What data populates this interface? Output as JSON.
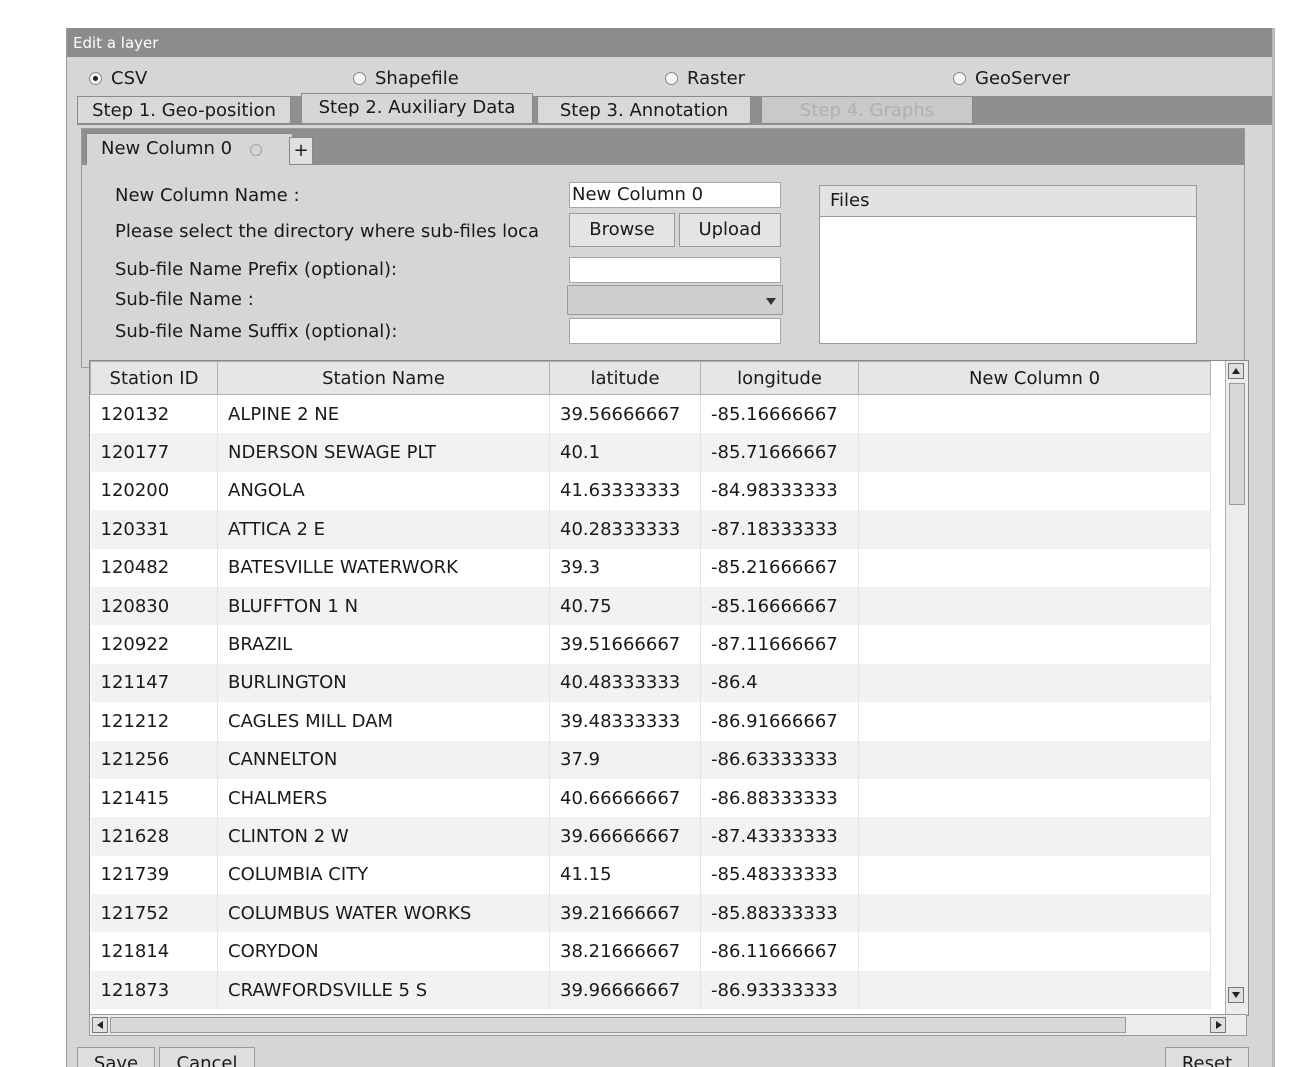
{
  "window": {
    "title": "Edit a layer"
  },
  "source_types": [
    {
      "label": "CSV",
      "selected": true
    },
    {
      "label": "Shapefile",
      "selected": false
    },
    {
      "label": "Raster",
      "selected": false
    },
    {
      "label": "GeoServer",
      "selected": false
    }
  ],
  "steps": [
    {
      "label": "Step 1. Geo-position"
    },
    {
      "label": "Step 2. Auxiliary Data"
    },
    {
      "label": "Step 3. Annotation"
    },
    {
      "label": "Step 4. Graphs"
    }
  ],
  "column_tab": {
    "label": "New Column 0",
    "add_label": "+"
  },
  "form": {
    "name_label": "New Column Name :",
    "name_value": "New Column 0",
    "dir_label": "Please select the directory where sub-files loca",
    "browse_label": "Browse",
    "upload_label": "Upload",
    "prefix_label": "Sub-file Name Prefix (optional):",
    "subfile_label": "Sub-file Name :",
    "suffix_label": "Sub-file Name Suffix (optional):"
  },
  "files": {
    "header": "Files"
  },
  "table": {
    "columns": [
      "Station ID",
      "Station Name",
      "latitude",
      "longitude",
      "New Column 0"
    ],
    "rows": [
      [
        "120132",
        "ALPINE 2 NE",
        "39.56666667",
        "-85.16666667",
        ""
      ],
      [
        "120177",
        "NDERSON SEWAGE PLT",
        "40.1",
        "-85.71666667",
        ""
      ],
      [
        "120200",
        "ANGOLA",
        "41.63333333",
        "-84.98333333",
        ""
      ],
      [
        "120331",
        "ATTICA 2 E",
        "40.28333333",
        "-87.18333333",
        ""
      ],
      [
        "120482",
        "BATESVILLE WATERWORK",
        "39.3",
        "-85.21666667",
        ""
      ],
      [
        "120830",
        "BLUFFTON 1 N",
        "40.75",
        "-85.16666667",
        ""
      ],
      [
        "120922",
        "BRAZIL",
        "39.51666667",
        "-87.11666667",
        ""
      ],
      [
        "121147",
        "BURLINGTON",
        "40.48333333",
        "-86.4",
        ""
      ],
      [
        "121212",
        "CAGLES MILL DAM",
        "39.48333333",
        "-86.91666667",
        ""
      ],
      [
        "121256",
        "CANNELTON",
        "37.9",
        "-86.63333333",
        ""
      ],
      [
        "121415",
        "CHALMERS",
        "40.66666667",
        "-86.88333333",
        ""
      ],
      [
        "121628",
        "CLINTON 2 W",
        "39.66666667",
        "-87.43333333",
        ""
      ],
      [
        "121739",
        "COLUMBIA CITY",
        "41.15",
        "-85.48333333",
        ""
      ],
      [
        "121752",
        "COLUMBUS WATER WORKS",
        "39.21666667",
        "-85.88333333",
        ""
      ],
      [
        "121814",
        "CORYDON",
        "38.21666667",
        "-86.11666667",
        ""
      ],
      [
        "121873",
        "CRAWFORDSVILLE 5 S",
        "39.96666667",
        "-86.93333333",
        ""
      ]
    ]
  },
  "footer": {
    "save_label": "Save",
    "cancel_label": "Cancel",
    "reset_label": "Reset"
  }
}
